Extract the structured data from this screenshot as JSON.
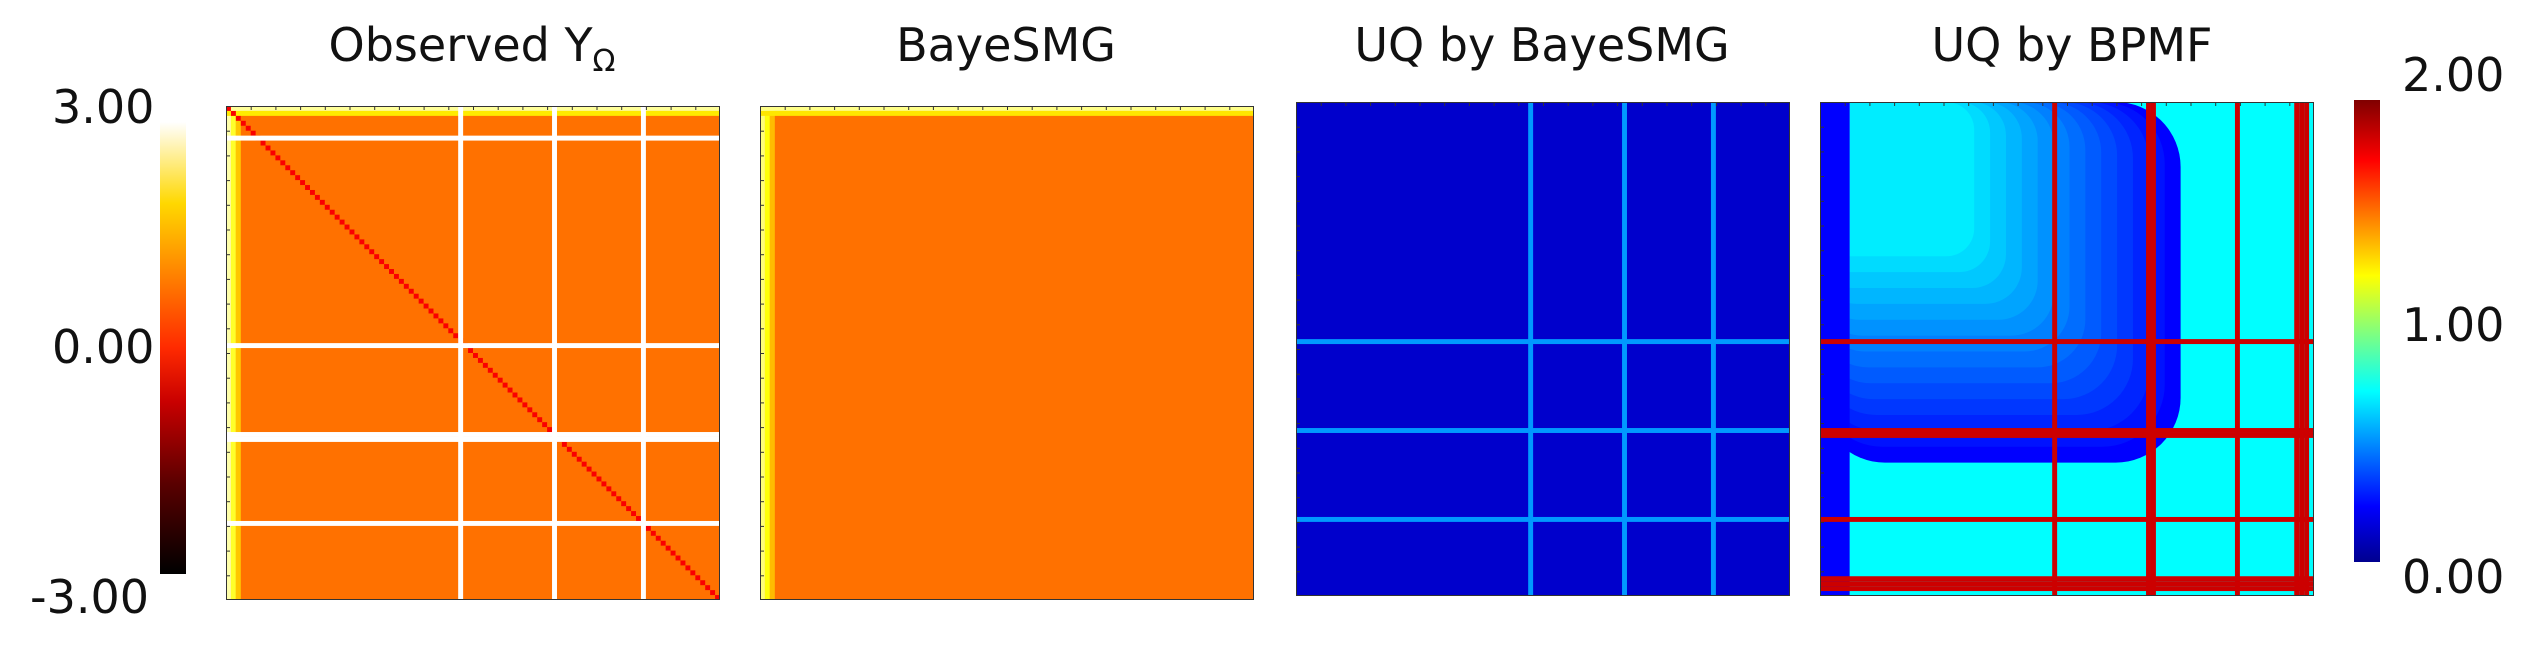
{
  "figure": {
    "titles": [
      "Observed Y",
      "BayeSMG",
      "UQ by BayeSMG",
      "UQ by BPMF"
    ],
    "title_subscript": "Ω",
    "left_colorbar": {
      "labels": [
        "3.00",
        "0.00",
        "-3.00"
      ],
      "min": -3.0,
      "max": 3.0,
      "colormap": "hot"
    },
    "right_colorbar": {
      "labels": [
        "2.00",
        "1.00",
        "0.00"
      ],
      "min": 0.0,
      "max": 2.0,
      "colormap": "jet"
    }
  },
  "chart_data": [
    {
      "type": "heatmap",
      "title": "Observed YΩ",
      "colormap": "hot",
      "vmin": -3.0,
      "vmax": 3.0,
      "matrix_size": 100,
      "background_value": 0.25,
      "left_edge_value": 2.5,
      "top_edge_value": 2.4,
      "diagonal_value": -0.8,
      "missing_rows": [
        6,
        48,
        66,
        67,
        84
      ],
      "missing_cols": [
        47,
        66,
        84
      ],
      "missing_color": "#ffffff"
    },
    {
      "type": "heatmap",
      "title": "BayeSMG",
      "colormap": "hot",
      "vmin": -3.0,
      "vmax": 3.0,
      "matrix_size": 100,
      "background_value": 0.25,
      "left_edge_value": 2.2,
      "top_edge_value": 2.3
    },
    {
      "type": "heatmap",
      "title": "UQ by BayeSMG",
      "colormap": "jet",
      "vmin": 0.0,
      "vmax": 2.0,
      "matrix_size": 100,
      "background_value": 0.15,
      "highlight_rows": [
        48,
        66,
        84
      ],
      "highlight_cols": [
        47,
        66,
        84
      ],
      "highlight_value": 0.55
    },
    {
      "type": "heatmap",
      "title": "UQ by BPMF",
      "colormap": "jet",
      "vmin": 0.0,
      "vmax": 2.0,
      "matrix_size": 100,
      "background_value": 0.75,
      "corner_value": 0.25,
      "missing_rows": [
        48,
        66,
        67,
        84,
        96,
        97,
        98
      ],
      "missing_cols": [
        47,
        66,
        67,
        84,
        96,
        97,
        98
      ],
      "missing_value": 1.85
    }
  ]
}
